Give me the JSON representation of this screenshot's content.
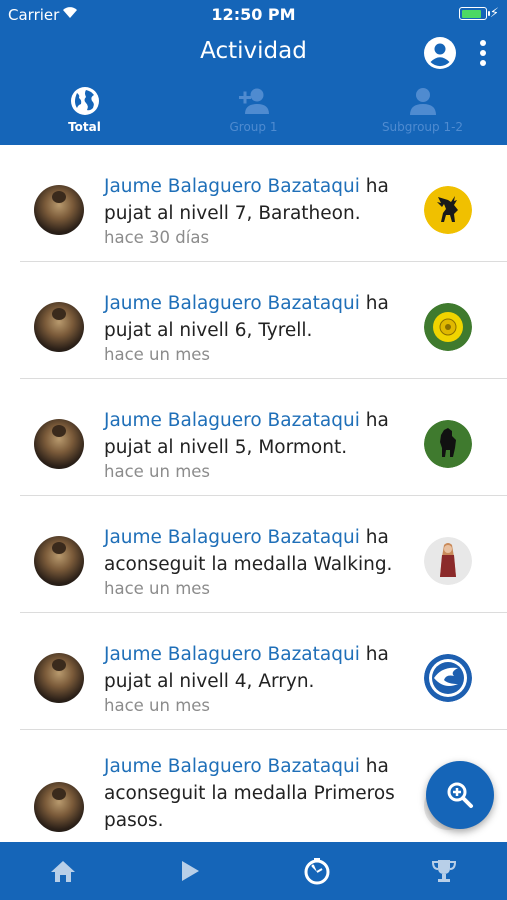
{
  "status_bar": {
    "carrier": "Carrier",
    "time": "12:50 PM",
    "battery_percent": 90
  },
  "header": {
    "title": "Actividad"
  },
  "tabs": [
    {
      "label": "Total",
      "icon": "globe-icon",
      "active": true
    },
    {
      "label": "Group 1",
      "icon": "add-person-icon",
      "active": false
    },
    {
      "label": "Subgroup 1-2",
      "icon": "person-icon",
      "active": false
    }
  ],
  "feed": [
    {
      "user": "Jaume Balaguero Bazataqui",
      "action": " ha pujat al nivell 7, Baratheon.",
      "time": "hace 30 días",
      "badge": "baratheon-stag-icon",
      "badge_color": "#f0c000"
    },
    {
      "user": "Jaume Balaguero Bazataqui",
      "action": " ha pujat al nivell 6, Tyrell.",
      "time": "hace un mes",
      "badge": "tyrell-rose-icon",
      "badge_color": "#3f7a2e"
    },
    {
      "user": "Jaume Balaguero Bazataqui",
      "action": " ha pujat al nivell 5, Mormont.",
      "time": "hace un mes",
      "badge": "mormont-bear-icon",
      "badge_color": "#3f7a2e"
    },
    {
      "user": "Jaume Balaguero Bazataqui",
      "action": " ha aconseguit la medalla Walking.",
      "time": "hace un mes",
      "badge": "walking-figure-icon",
      "badge_color": "#e8e8e8"
    },
    {
      "user": "Jaume Balaguero Bazataqui",
      "action": " ha pujat al nivell 4, Arryn.",
      "time": "hace un mes",
      "badge": "arryn-falcon-icon",
      "badge_color": "#1d5fb0"
    },
    {
      "user": "Jaume Balaguero Bazataqui",
      "action": " ha aconseguit la medalla Primeros pasos.",
      "time": "",
      "badge": "",
      "badge_color": "#e8e8e8"
    }
  ],
  "bottom_nav": [
    {
      "icon": "home-icon"
    },
    {
      "icon": "play-icon"
    },
    {
      "icon": "stopwatch-icon"
    },
    {
      "icon": "trophy-icon"
    }
  ],
  "colors": {
    "primary": "#1565b8",
    "link": "#1f6fb8",
    "secondary_text": "#8c8c8c"
  }
}
